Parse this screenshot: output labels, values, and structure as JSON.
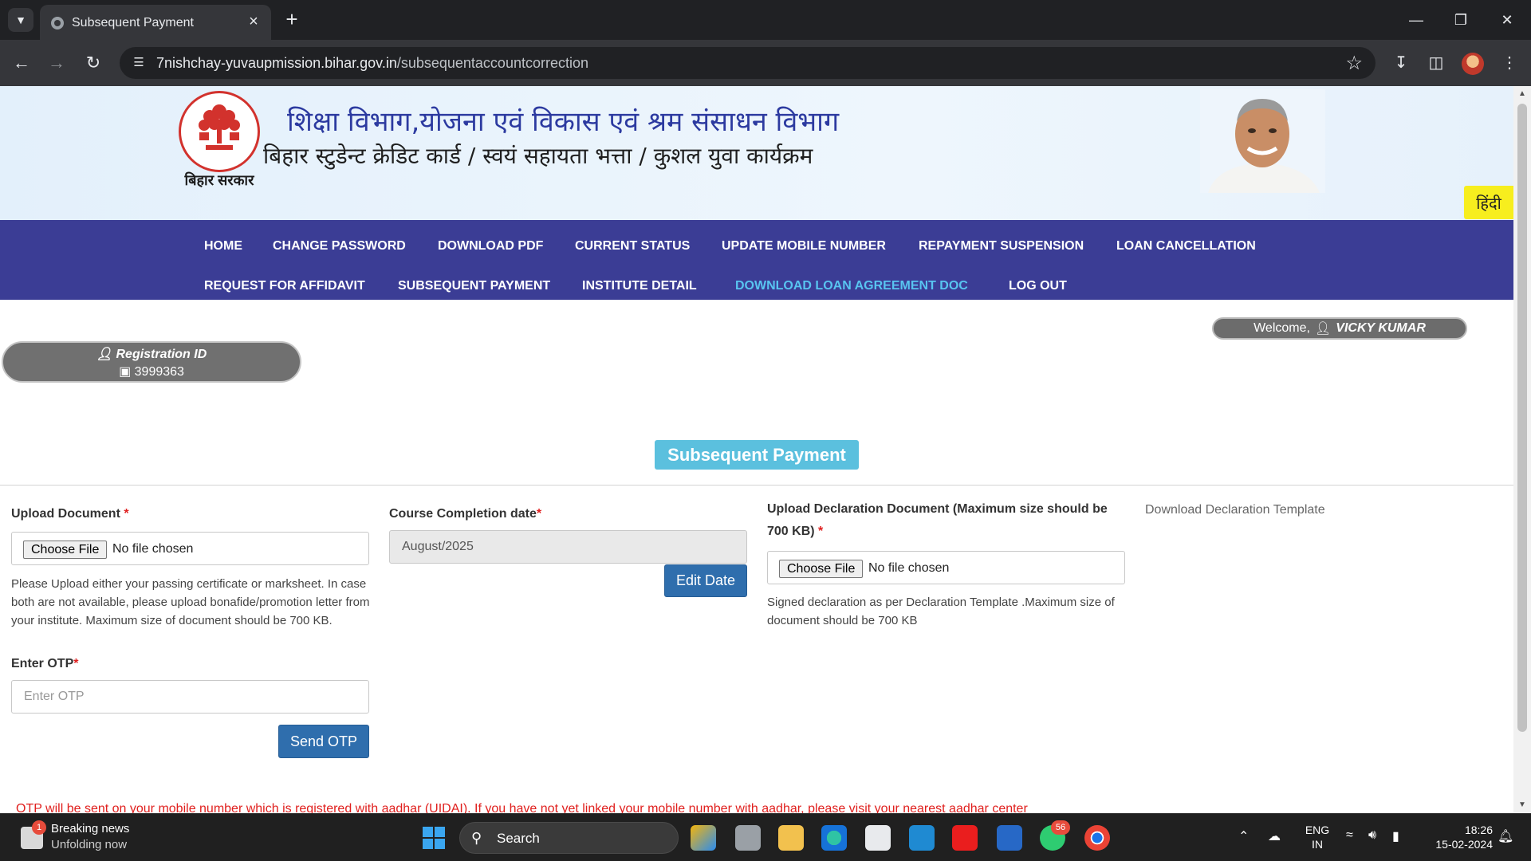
{
  "browser": {
    "tab_title": "Subsequent Payment",
    "url_host": "7nishchay-yuvaupmission.bihar.gov.in",
    "url_path": "/subsequentaccountcorrection"
  },
  "header": {
    "emblem_caption": "बिहार सरकार",
    "title": "शिक्षा विभाग,योजना एवं विकास एवं श्रम संसाधन विभाग",
    "subtitle": "बिहार स्टुडेन्ट क्रेडिट कार्ड / स्वयं सहायता भत्ता / कुशल युवा कार्यक्रम",
    "lang_toggle": "हिंदी"
  },
  "nav": {
    "home": "HOME",
    "change_password": "CHANGE PASSWORD",
    "download_pdf": "DOWNLOAD PDF",
    "current_status": "CURRENT STATUS",
    "update_mobile": "UPDATE MOBILE NUMBER",
    "repayment_suspension": "REPAYMENT SUSPENSION",
    "loan_cancellation": "LOAN CANCELLATION",
    "request_affidavit": "REQUEST FOR AFFIDAVIT",
    "subsequent_payment": "SUBSEQUENT PAYMENT",
    "institute_detail": "INSTITUTE DETAIL",
    "download_loan_agreement": "DOWNLOAD LOAN AGREEMENT DOC",
    "log_out": "LOG OUT"
  },
  "user": {
    "welcome_label": "Welcome,",
    "name": "VICKY KUMAR",
    "registration_label": "Registration ID",
    "registration_id": "3999363"
  },
  "form": {
    "section_title": "Subsequent Payment",
    "upload_document_label": "Upload Document",
    "choose_file_label": "Choose File",
    "no_file_text": "No file chosen",
    "upload_help": "Please Upload either your passing certificate or marksheet. In case both are not available, please upload bonafide/promotion letter from your institute. Maximum size of document should be 700 KB.",
    "course_completion_label": "Course Completion date",
    "course_completion_value": "August/2025",
    "edit_date_label": "Edit Date",
    "declaration_label": "Upload Declaration Document (Maximum size should be 700 KB)",
    "declaration_help": "Signed declaration as per Declaration Template .Maximum size of document should be 700 KB",
    "download_template_label": "Download Declaration Template",
    "otp_label": "Enter OTP",
    "otp_placeholder": "Enter OTP",
    "send_otp_label": "Send OTP",
    "otp_note": "OTP will be sent on your mobile number which is registered with aadhar (UIDAI). If you have not yet linked your mobile number with aadhar, please visit your nearest aadhar center"
  },
  "taskbar": {
    "news_title": "Breaking news",
    "news_subtitle": "Unfolding now",
    "news_badge": "1",
    "search_label": "Search",
    "whatsapp_badge": "56",
    "lang_top": "ENG",
    "lang_bottom": "IN",
    "time": "18:26",
    "date": "15-02-2024"
  },
  "colors": {
    "nav_bg": "#3b3d95",
    "nav_active": "#58c4f0",
    "section_title_bg": "#5bc0de",
    "primary_button": "#2f6ead",
    "required_star": "#e02020",
    "lang_toggle_bg": "#f7ee1e"
  }
}
